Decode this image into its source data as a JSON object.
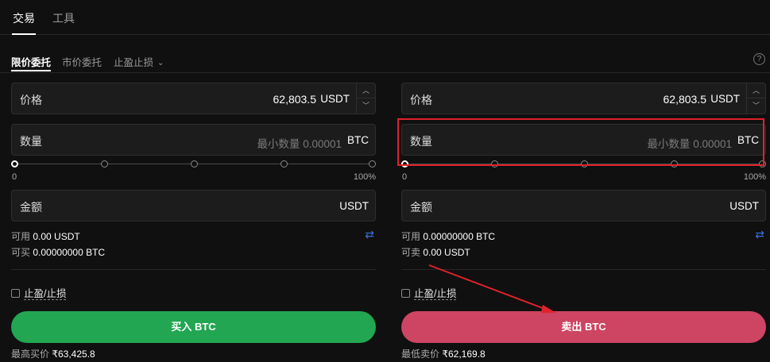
{
  "top_tabs": [
    "交易",
    "工具"
  ],
  "order_tabs": {
    "limit": "限价委托",
    "market": "市价委托",
    "tpsl": "止盈止损"
  },
  "help_label": "?",
  "buy": {
    "price_label": "价格",
    "price_value": "62,803.5",
    "price_unit": "USDT",
    "qty_label": "数量",
    "qty_placeholder": "最小数量 0.00001",
    "qty_unit": "BTC",
    "slider_min": "0",
    "slider_max": "100%",
    "slider_value": 0,
    "amount_label": "金额",
    "amount_unit": "USDT",
    "avail_label": "可用",
    "avail_value": "0.00 USDT",
    "can_label": "可买",
    "can_value": "0.00000000 BTC",
    "tpsl_label": "止盈/止损",
    "button_label": "买入 BTC",
    "best_label": "最高买价",
    "best_value": "₹63,425.8"
  },
  "sell": {
    "price_label": "价格",
    "price_value": "62,803.5",
    "price_unit": "USDT",
    "qty_label": "数量",
    "qty_placeholder": "最小数量 0.00001",
    "qty_unit": "BTC",
    "slider_min": "0",
    "slider_max": "100%",
    "slider_value": 0,
    "amount_label": "金额",
    "amount_unit": "USDT",
    "avail_label": "可用",
    "avail_value": "0.00000000 BTC",
    "can_label": "可卖",
    "can_value": "0.00 USDT",
    "tpsl_label": "止盈/止损",
    "button_label": "卖出 BTC",
    "best_label": "最低卖价",
    "best_value": "₹62,169.8"
  },
  "colors": {
    "buy": "#22a652",
    "sell": "#cd4562",
    "annotation": "#e0222a",
    "swap_icon": "#3a6fe0"
  },
  "icons": [
    "chevron-down-icon",
    "help-icon",
    "swap-icon",
    "chevron-up-icon",
    "checkbox-icon"
  ]
}
